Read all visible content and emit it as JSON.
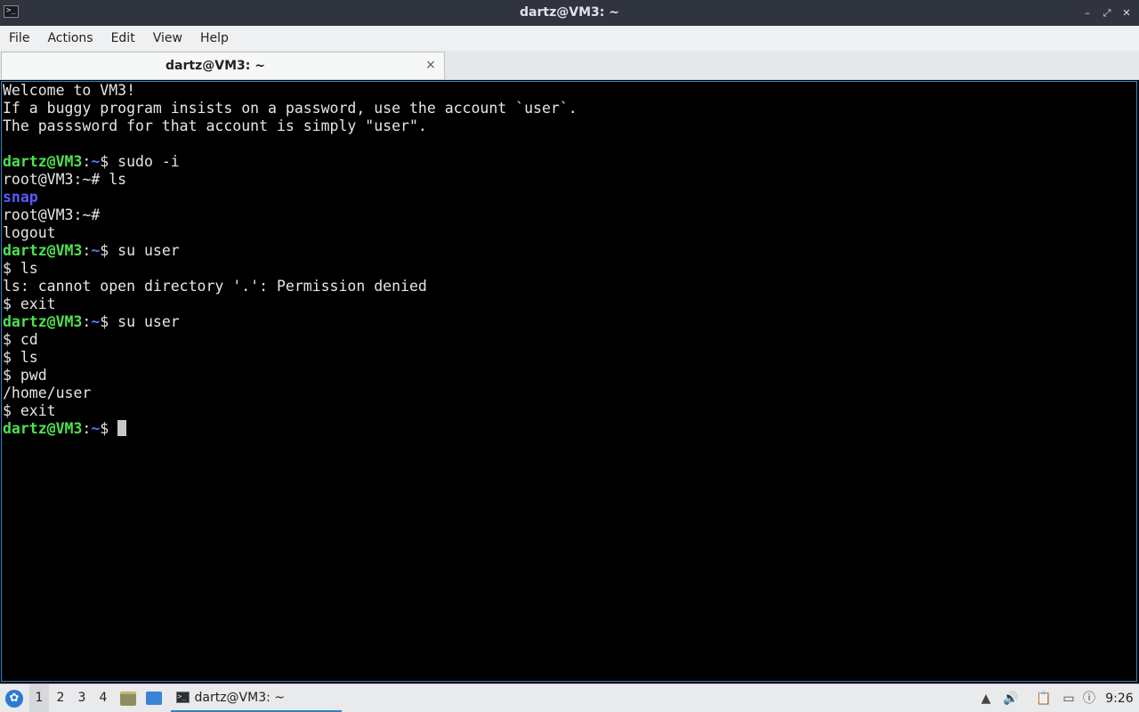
{
  "window": {
    "title": "dartz@VM3: ~"
  },
  "menu": [
    "File",
    "Actions",
    "Edit",
    "View",
    "Help"
  ],
  "tab": {
    "label": "dartz@VM3: ~",
    "close": "×"
  },
  "terminal": {
    "lines": [
      [
        {
          "t": "Welcome to VM3!"
        }
      ],
      [
        {
          "t": "If a buggy program insists on a password, use the account `user`."
        }
      ],
      [
        {
          "t": "The passsword for that account is simply \"user\"."
        }
      ],
      [
        {
          "t": ""
        }
      ],
      [
        {
          "t": "dartz@VM3",
          "c": "p-user"
        },
        {
          "t": ":"
        },
        {
          "t": "~",
          "c": "p-path"
        },
        {
          "t": "$ sudo -i"
        }
      ],
      [
        {
          "t": "root@VM3:~# ls"
        }
      ],
      [
        {
          "t": "snap",
          "c": "dir"
        }
      ],
      [
        {
          "t": "root@VM3:~#"
        }
      ],
      [
        {
          "t": "logout"
        }
      ],
      [
        {
          "t": "dartz@VM3",
          "c": "p-user"
        },
        {
          "t": ":"
        },
        {
          "t": "~",
          "c": "p-path"
        },
        {
          "t": "$ su user"
        }
      ],
      [
        {
          "t": "$ ls"
        }
      ],
      [
        {
          "t": "ls: cannot open directory '.': Permission denied"
        }
      ],
      [
        {
          "t": "$ exit"
        }
      ],
      [
        {
          "t": "dartz@VM3",
          "c": "p-user"
        },
        {
          "t": ":"
        },
        {
          "t": "~",
          "c": "p-path"
        },
        {
          "t": "$ su user"
        }
      ],
      [
        {
          "t": "$ cd"
        }
      ],
      [
        {
          "t": "$ ls"
        }
      ],
      [
        {
          "t": "$ pwd"
        }
      ],
      [
        {
          "t": "/home/user"
        }
      ],
      [
        {
          "t": "$ exit"
        }
      ],
      [
        {
          "t": "dartz@VM3",
          "c": "p-user"
        },
        {
          "t": ":"
        },
        {
          "t": "~",
          "c": "p-path"
        },
        {
          "t": "$ "
        },
        {
          "cursor": true
        }
      ]
    ]
  },
  "taskbar": {
    "workspaces": [
      "1",
      "2",
      "3",
      "4"
    ],
    "active_workspace": "1",
    "task_label": "dartz@VM3: ~",
    "clock": "9:26"
  },
  "icons": {
    "start": "lxqt-start-icon",
    "file_manager": "file-manager-icon",
    "desktop": "show-desktop-icon",
    "terminal": "terminal-icon",
    "volume": "volume-icon",
    "clipboard": "clipboard-icon",
    "network": "network-icon",
    "notification": "notification-icon",
    "update": "update-icon"
  }
}
